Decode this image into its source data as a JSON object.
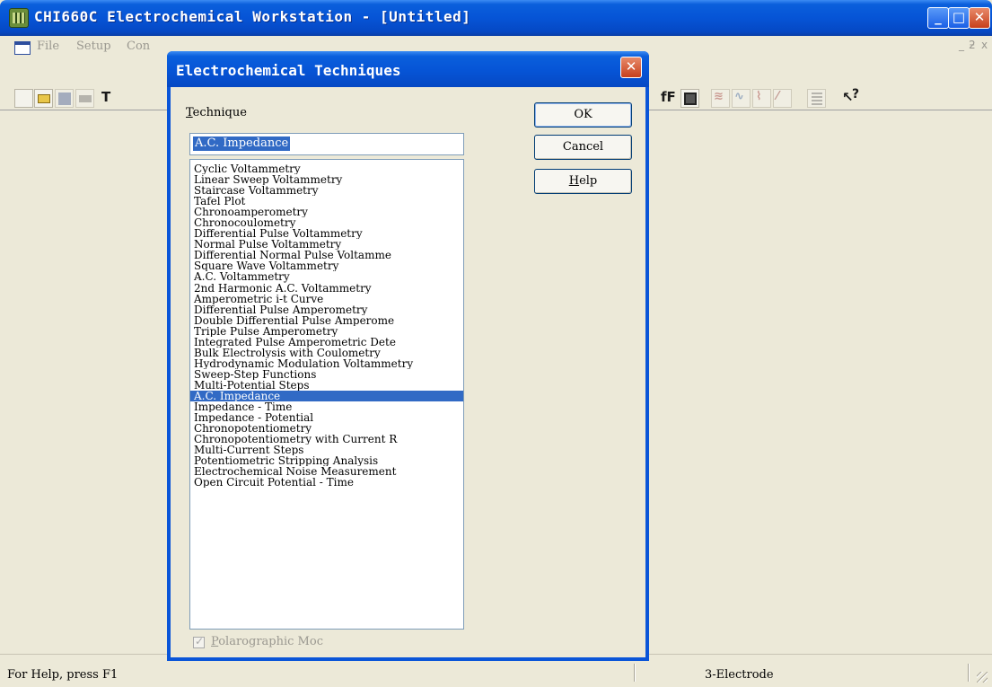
{
  "window": {
    "title": "CHI660C Electrochemical Workstation - [Untitled]",
    "minimize_glyph": "_",
    "maximize_glyph": "□",
    "close_glyph": "✕"
  },
  "menu": {
    "file": "File",
    "setup": "Setup",
    "control": "Con",
    "mdi_min": "_",
    "mdi_restore": "ƻ",
    "mdi_close": "x"
  },
  "toolbar": {
    "icons": [
      "new-icon",
      "open-icon",
      "save-icon",
      "print-icon",
      "text-icon",
      "font-icon",
      "clipboard-icon",
      "sweep-icon",
      "wave-icon",
      "graph-icon",
      "pen-icon",
      "list-icon",
      "context-help-icon"
    ],
    "font_label": "fF",
    "help_label": "?"
  },
  "dialog": {
    "title": "Electrochemical Techniques",
    "close_glyph": "✕",
    "technique_label": "Technique",
    "selected_technique": "A.C. Impedance",
    "ok_label": "OK",
    "cancel_label": "Cancel",
    "help_label": "Help",
    "techniques": [
      "Cyclic Voltammetry",
      "Linear Sweep Voltammetry",
      "Staircase Voltammetry",
      "Tafel Plot",
      "Chronoamperometry",
      "Chronocoulometry",
      "Differential Pulse Voltammetry",
      "Normal Pulse Voltammetry",
      "Differential Normal Pulse Voltamme",
      "Square Wave Voltammetry",
      "A.C. Voltammetry",
      "2nd Harmonic A.C. Voltammetry",
      "Amperometric i-t Curve",
      "Differential Pulse Amperometry",
      "Double Differential Pulse Amperome",
      "Triple Pulse Amperometry",
      "Integrated Pulse Amperometric Dete",
      "Bulk Electrolysis with Coulometry",
      "Hydrodynamic Modulation Voltammetry",
      "Sweep-Step Functions",
      "Multi-Potential Steps",
      "A.C. Impedance",
      "Impedance - Time",
      "Impedance - Potential",
      "Chronopotentiometry",
      "Chronopotentiometry with Current R",
      "Multi-Current Steps",
      "Potentiometric Stripping Analysis",
      "Electrochemical Noise Measurement",
      "Open Circuit Potential - Time"
    ],
    "selected_index": 21,
    "polarographic_label": "Polarographic Moc",
    "polarographic_checked": true
  },
  "status": {
    "help_text": "For Help, press F1",
    "electrode": "3-Electrode"
  }
}
